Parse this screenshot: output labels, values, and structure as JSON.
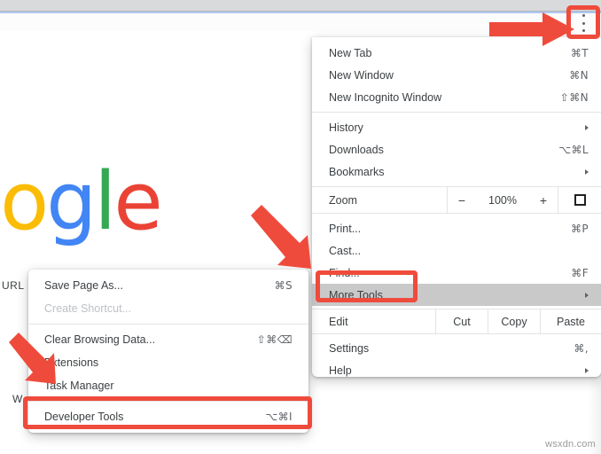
{
  "page": {
    "logo_text": "oogle",
    "logo_letters": [
      {
        "ch": "o",
        "color": "#EA4335"
      },
      {
        "ch": "o",
        "color": "#FBBC05"
      },
      {
        "ch": "g",
        "color": "#4285F4"
      },
      {
        "ch": "l",
        "color": "#34A853"
      },
      {
        "ch": "e",
        "color": "#EA4335"
      }
    ],
    "fragment_url": "URL",
    "fragment_w": "W",
    "watermark": "wsxdn.com"
  },
  "toolbar": {
    "menu_button_name": "Chrome menu",
    "extension_icon_name": "extension-icon"
  },
  "main_menu": {
    "items": [
      {
        "label": "New Tab",
        "accel": "⌘T",
        "type": "item"
      },
      {
        "label": "New Window",
        "accel": "⌘N",
        "type": "item"
      },
      {
        "label": "New Incognito Window",
        "accel": "⇧⌘N",
        "type": "item"
      },
      {
        "type": "separator"
      },
      {
        "label": "History",
        "accel": "",
        "submenu": true,
        "type": "item"
      },
      {
        "label": "Downloads",
        "accel": "⌥⌘L",
        "type": "item"
      },
      {
        "label": "Bookmarks",
        "accel": "",
        "submenu": true,
        "type": "item"
      }
    ],
    "zoom_row": {
      "label": "Zoom",
      "minus": "−",
      "value": "100%",
      "plus": "+",
      "fullscreen_name": "fullscreen-icon"
    },
    "items_mid": [
      {
        "label": "Print...",
        "accel": "⌘P",
        "type": "item"
      },
      {
        "label": "Cast...",
        "accel": "",
        "type": "item"
      },
      {
        "label": "Find...",
        "accel": "⌘F",
        "type": "item"
      },
      {
        "label": "More Tools",
        "accel": "",
        "submenu": true,
        "type": "item",
        "hovered": true
      }
    ],
    "edit_row": {
      "label": "Edit",
      "cut": "Cut",
      "copy": "Copy",
      "paste": "Paste"
    },
    "items_bottom": [
      {
        "label": "Settings",
        "accel": "⌘,",
        "type": "item"
      },
      {
        "label": "Help",
        "accel": "",
        "submenu": true,
        "type": "item"
      }
    ]
  },
  "sub_menu": {
    "title": "More Tools",
    "items": [
      {
        "label": "Save Page As...",
        "accel": "⌘S",
        "disabled": false
      },
      {
        "label": "Create Shortcut...",
        "accel": "",
        "disabled": true
      },
      {
        "type": "separator"
      },
      {
        "label": "Clear Browsing Data...",
        "accel": "⇧⌘⌫",
        "disabled": false
      },
      {
        "label": "Extensions",
        "accel": "",
        "disabled": false
      },
      {
        "label": "Task Manager",
        "accel": "",
        "disabled": false
      },
      {
        "type": "separator"
      },
      {
        "label": "Developer Tools",
        "accel": "⌥⌘I",
        "disabled": false,
        "highlighted": true
      }
    ]
  },
  "annotations": {
    "accent_color": "#ef4b3c",
    "boxes": [
      {
        "name": "menu-button-highlight"
      },
      {
        "name": "more-tools-highlight"
      },
      {
        "name": "developer-tools-highlight"
      }
    ],
    "arrows": [
      {
        "name": "arrow-to-menu-button",
        "direction": "right"
      },
      {
        "name": "arrow-to-more-tools",
        "direction": "down-right"
      },
      {
        "name": "arrow-to-developer-tools",
        "direction": "down-right"
      }
    ]
  }
}
